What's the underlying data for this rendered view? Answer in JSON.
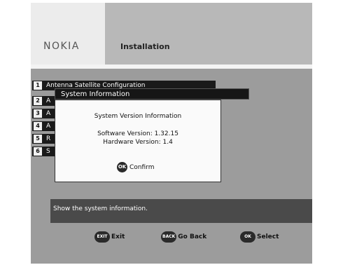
{
  "header": {
    "logo": "NOKIA",
    "title": "Installation"
  },
  "menu": {
    "items": [
      {
        "number": "1",
        "label": "Antenna Satellite Configuration"
      },
      {
        "number": "2",
        "label": "A"
      },
      {
        "number": "3",
        "label": "A"
      },
      {
        "number": "4",
        "label": "A"
      },
      {
        "number": "5",
        "label": "R"
      },
      {
        "number": "6",
        "label": "S"
      }
    ]
  },
  "dialog": {
    "title": "System Information",
    "heading": "System Version Information",
    "software": "Software Version: 1.32.15",
    "hardware": "Hardware Version: 1.4",
    "confirm_icon": "OK",
    "confirm_label": "Confirm"
  },
  "info": {
    "text": "Show the system information."
  },
  "footer": {
    "exit": {
      "icon": "EXIT",
      "label": "Exit"
    },
    "back": {
      "icon": "BACK",
      "label": "Go Back"
    },
    "select": {
      "icon": "OK",
      "label": "Select"
    }
  }
}
